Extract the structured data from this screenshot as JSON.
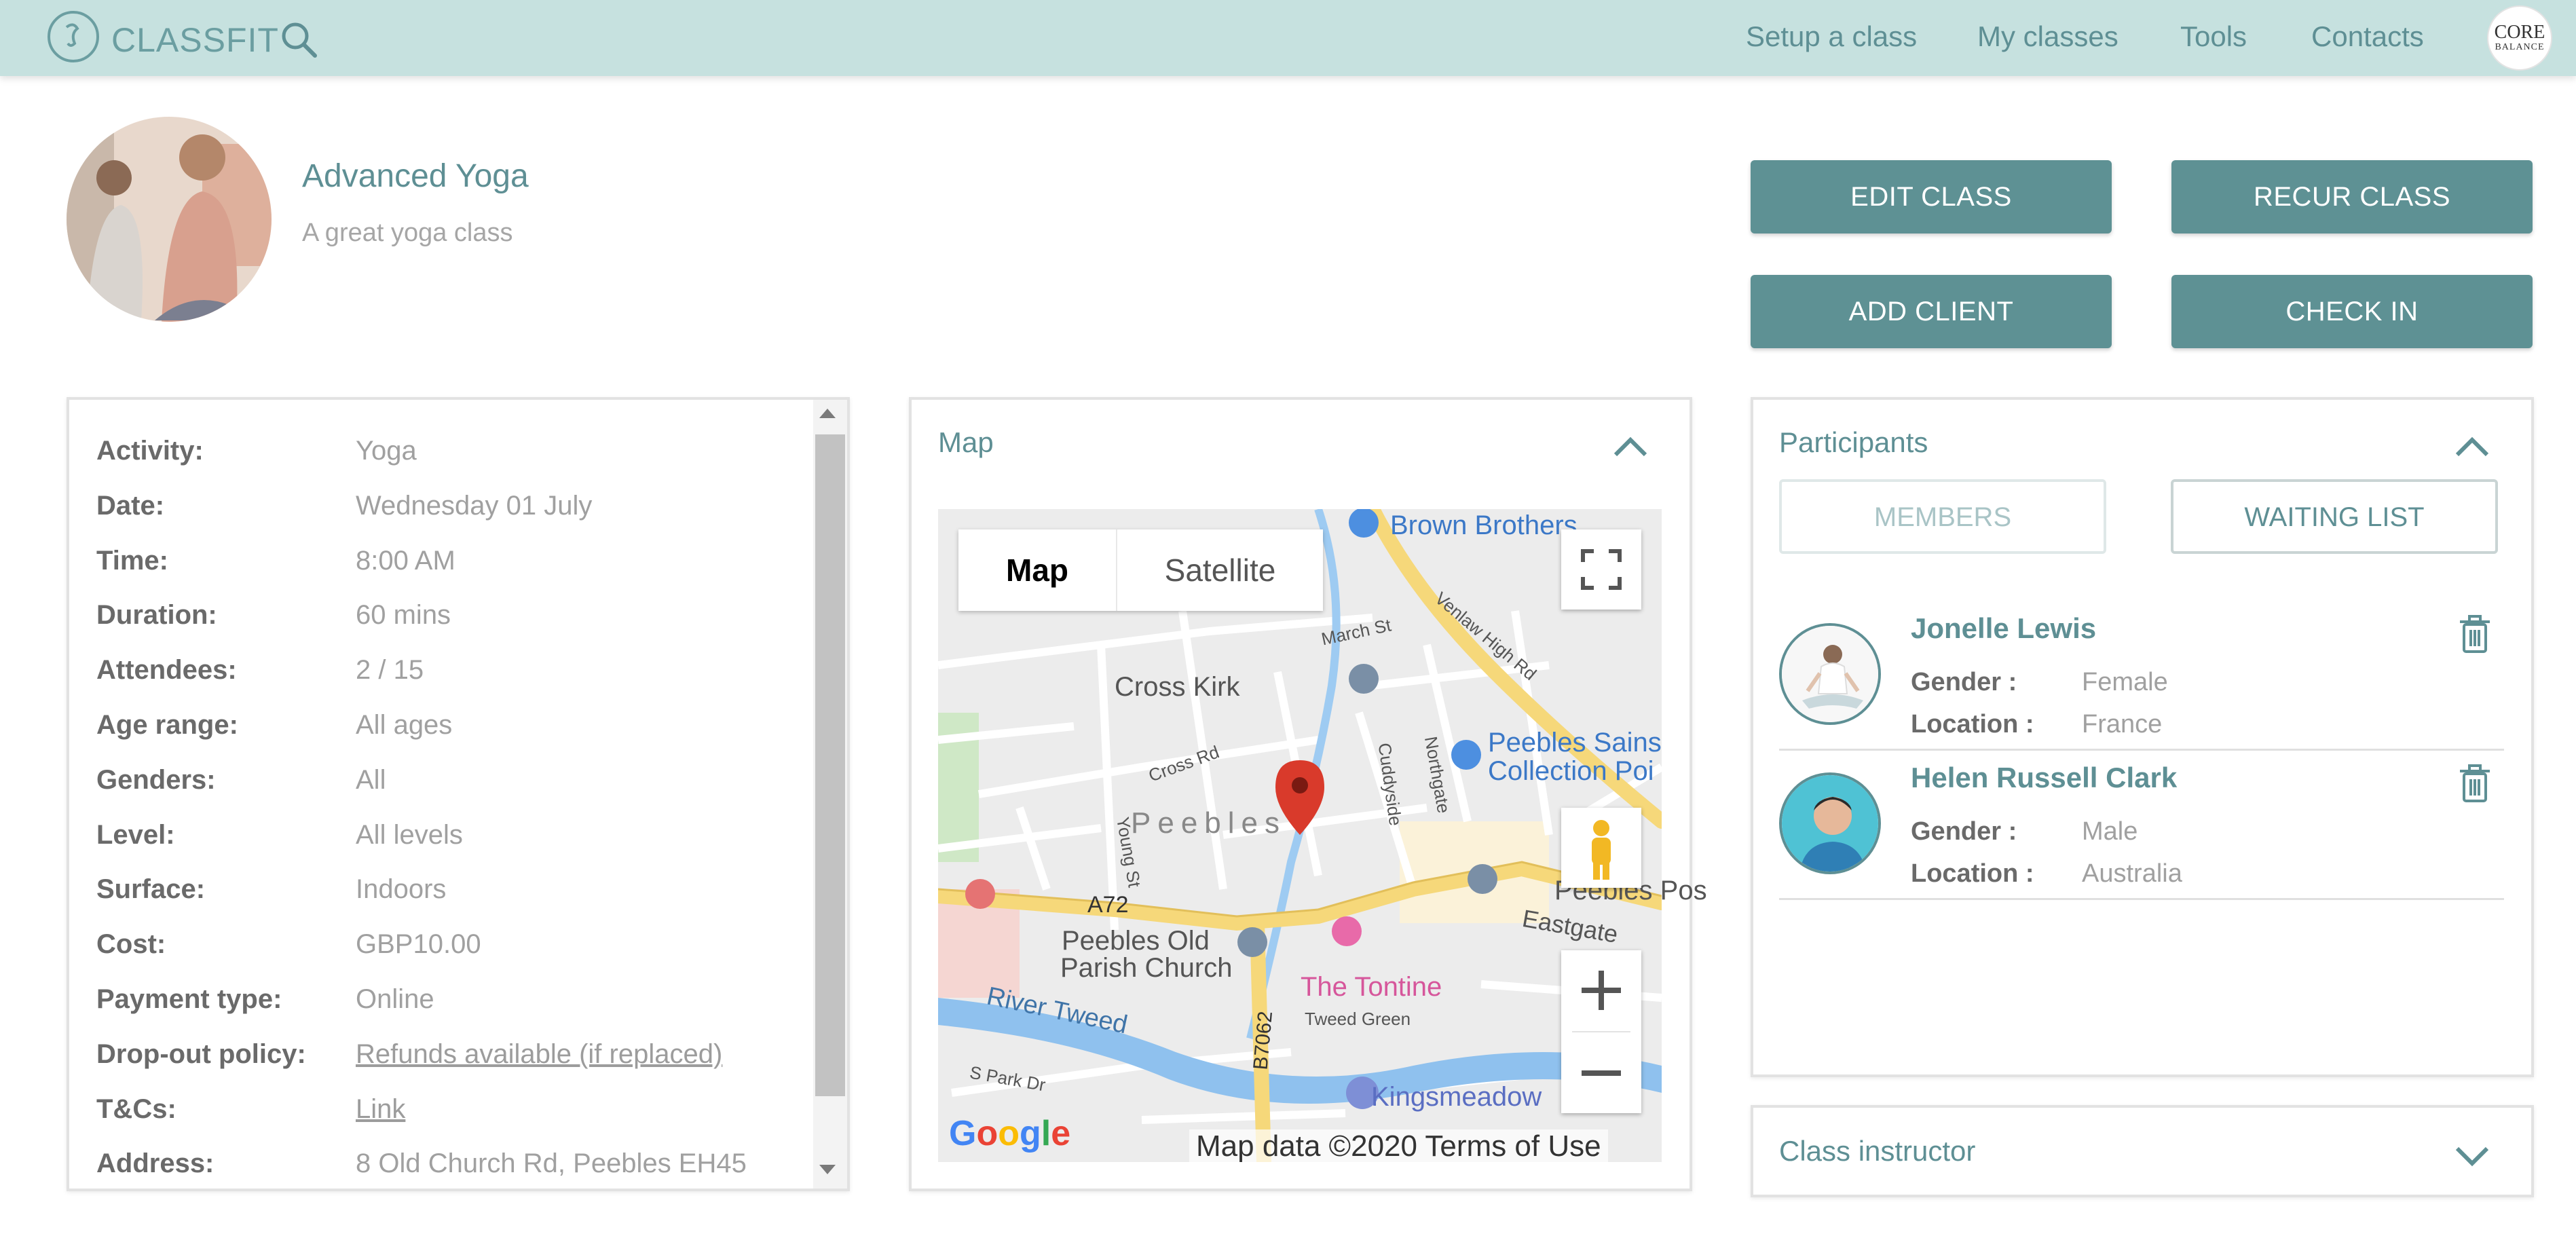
{
  "app": {
    "name": "CLASSFIT"
  },
  "nav": {
    "items": [
      "Setup a class",
      "My classes",
      "Tools",
      "Contacts"
    ],
    "brand_line1": "CORE",
    "brand_line2": "BALANCE"
  },
  "class": {
    "title": "Advanced Yoga",
    "subtitle": "A great yoga class"
  },
  "actions": {
    "edit": "EDIT CLASS",
    "recur": "RECUR CLASS",
    "add_client": "ADD CLIENT",
    "check_in": "CHECK IN"
  },
  "details": [
    {
      "label": "Activity:",
      "value": "Yoga"
    },
    {
      "label": "Date:",
      "value": "Wednesday 01 July"
    },
    {
      "label": "Time:",
      "value": "8:00 AM"
    },
    {
      "label": "Duration:",
      "value": "60 mins"
    },
    {
      "label": "Attendees:",
      "value": "2 / 15"
    },
    {
      "label": "Age range:",
      "value": "All ages"
    },
    {
      "label": "Genders:",
      "value": "All"
    },
    {
      "label": "Level:",
      "value": "All levels"
    },
    {
      "label": "Surface:",
      "value": "Indoors"
    },
    {
      "label": "Cost:",
      "value": "GBP10.00"
    },
    {
      "label": "Payment type:",
      "value": "Online"
    },
    {
      "label": "Drop-out policy:",
      "value": "Refunds available (if replaced)"
    },
    {
      "label": "T&Cs:",
      "value": "Link"
    },
    {
      "label": "Address:",
      "value": "8 Old Church Rd, Peebles EH45"
    }
  ],
  "map": {
    "panel_title": "Map",
    "tab_map": "Map",
    "tab_satellite": "Satellite",
    "credit": "Map data ©2020   Terms of Use",
    "google": "Google",
    "labels": {
      "brown_brothers": "Brown Brothers",
      "cross_kirk": "Cross Kirk",
      "peebles_sains": "Peebles Sains",
      "collection_poi": "Collection Poi",
      "peebles": "Peebles",
      "a72": "A72",
      "peebles_old": "Peebles Old",
      "parish_church": "Parish Church",
      "the_tontine": "The Tontine",
      "eastgate": "Eastgate",
      "peebles_pos": "Peebles Pos",
      "river_tweed": "River Tweed",
      "tweed_green": "Tweed Green",
      "b7062": "B7062",
      "kingsmeadow": "Kingsmeadow",
      "march_st": "March St",
      "cross_rd": "Cross Rd",
      "young_st": "Young St",
      "venlaw": "Venlaw High Rd",
      "northgate": "Northgate",
      "cuddyside": "Cuddyside",
      "s_park_dr": "S Park Dr"
    },
    "colors": {
      "road": "#f6d87a",
      "water": "#8fc1ee",
      "land": "#ececec",
      "park": "#cfe8c6",
      "pin": "#d93a2b"
    }
  },
  "participants": {
    "title": "Participants",
    "tab_members": "MEMBERS",
    "tab_waiting": "WAITING LIST",
    "gender_label": "Gender :",
    "location_label": "Location :",
    "list": [
      {
        "name": "Jonelle Lewis",
        "gender": "Female",
        "location": "France"
      },
      {
        "name": "Helen Russell Clark",
        "gender": "Male",
        "location": "Australia"
      }
    ]
  },
  "instructor": {
    "title": "Class instructor"
  },
  "icons": {
    "logo": "classfit-logo-icon",
    "search": "search-icon",
    "chevron_up": "chevron-up-icon",
    "chevron_down": "chevron-down-icon",
    "trash": "trash-icon",
    "fullscreen": "fullscreen-icon",
    "pegman": "pegman-icon",
    "zoom_in": "zoom-in-icon",
    "zoom_out": "zoom-out-icon",
    "map_pin": "map-pin-icon"
  },
  "colors": {
    "topbar": "#c6e1df",
    "accent": "#5e9194",
    "text_accent": "#5e8f94"
  }
}
